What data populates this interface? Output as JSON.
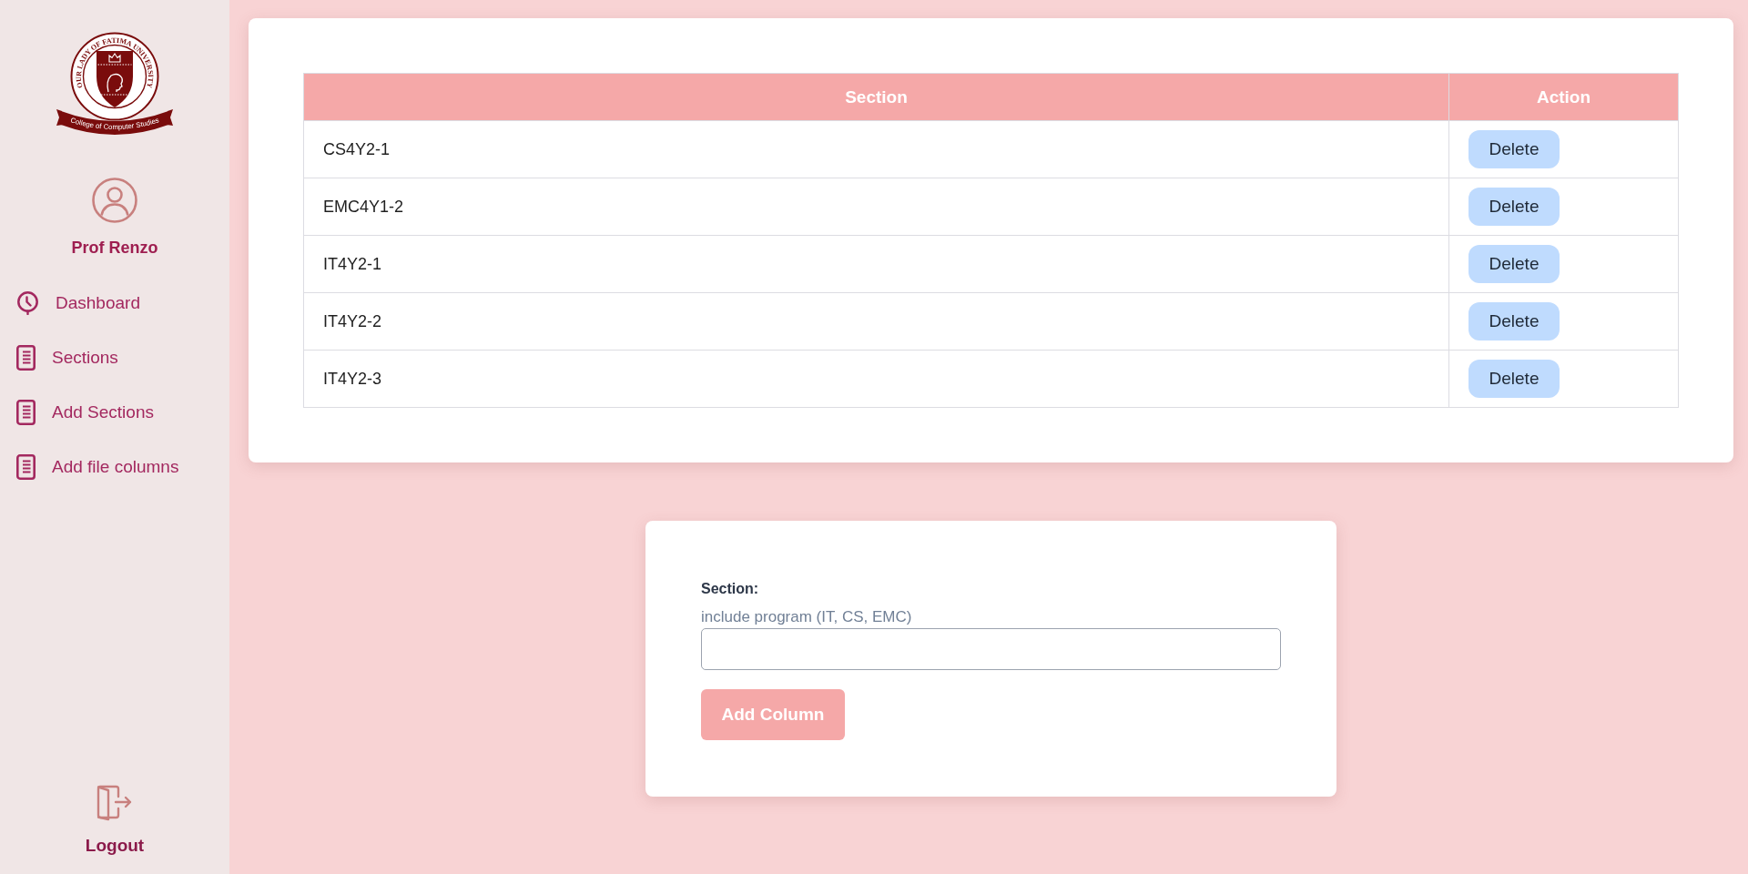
{
  "sidebar": {
    "logo": {
      "ring_text": "OUR LADY OF FATIMA UNIVERSITY",
      "ribbon_text": "College of Computer Studies"
    },
    "user": {
      "name": "Prof Renzo"
    },
    "nav": [
      {
        "label": "Dashboard",
        "kind": "dashboard"
      },
      {
        "label": "Sections",
        "kind": "page"
      },
      {
        "label": "Add Sections",
        "kind": "page"
      },
      {
        "label": "Add file columns",
        "kind": "page"
      }
    ],
    "logout": {
      "label": "Logout"
    }
  },
  "sections_table": {
    "columns": [
      "Section",
      "Action"
    ],
    "rows": [
      {
        "section": "CS4Y2-1",
        "action": "Delete"
      },
      {
        "section": "EMC4Y1-2",
        "action": "Delete"
      },
      {
        "section": "IT4Y2-1",
        "action": "Delete"
      },
      {
        "section": "IT4Y2-2",
        "action": "Delete"
      },
      {
        "section": "IT4Y2-3",
        "action": "Delete"
      }
    ]
  },
  "add_form": {
    "label": "Section:",
    "hint": "include program (IT, CS, EMC)",
    "button": "Add Column"
  }
}
